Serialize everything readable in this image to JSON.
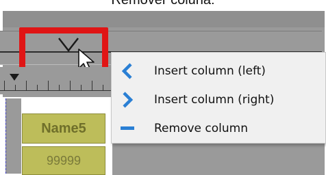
{
  "caption": "Remover coluna:",
  "column_header": {
    "chevron_icon": "chevron-down-icon"
  },
  "cells": {
    "name": "Name5",
    "value": "99999"
  },
  "context_menu": {
    "items": [
      {
        "label": "Insert column (left)",
        "icon": "chevron-left-icon",
        "icon_color": "#2a7fd4"
      },
      {
        "label": "Insert column (right)",
        "icon": "chevron-right-icon",
        "icon_color": "#2a7fd4"
      },
      {
        "label": "Remove column",
        "icon": "minus-icon",
        "icon_color": "#2a7fd4"
      }
    ]
  },
  "colors": {
    "highlight": "#e01515",
    "cell_fill": "#bdbd5a",
    "menu_background": "#f0f0f0"
  }
}
